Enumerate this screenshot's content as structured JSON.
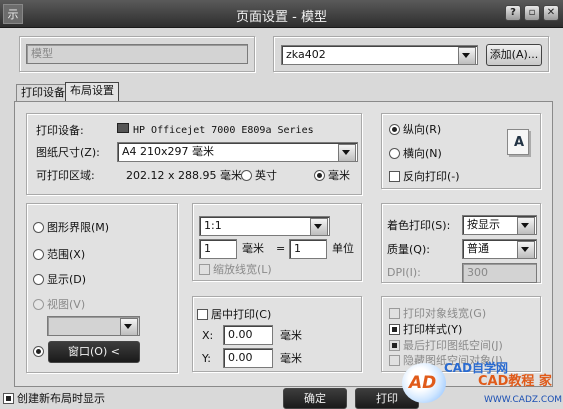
{
  "window": {
    "title": "页面设置 - 模型",
    "sys_icon": "示"
  },
  "top": {
    "layout_name_value": "模型",
    "printer_value": "zka402",
    "add_button": "添加(A)..."
  },
  "tabs": [
    {
      "label": "打印设备"
    },
    {
      "label": "布局设置"
    }
  ],
  "paper": {
    "device_label": "打印设备:",
    "device_value": "HP Officejet 7000 E809a Series",
    "size_label": "图纸尺寸(Z):",
    "size_value": "A4 210x297 毫米",
    "area_label": "可打印区域:",
    "area_value": "202.12 x 288.95 毫米",
    "unit_inch": "英寸",
    "unit_mm": "毫米"
  },
  "orientation": {
    "portrait": "纵向(R)",
    "landscape": "横向(N)",
    "reverse": "反向打印(-)",
    "preview_letter": "A"
  },
  "print_area": {
    "limits": "图形界限(M)",
    "extents": "范围(X)",
    "display": "显示(D)",
    "view": "视图(V)",
    "window_button": "窗口(O) <"
  },
  "scale": {
    "ratio": "1:1",
    "value1": "1",
    "unit1": "毫米",
    "eq": "=",
    "value2": "1",
    "unit2": "单位",
    "scale_lw": "缩放线宽(L)"
  },
  "offset": {
    "center": "居中打印(C)",
    "x_label": "X:",
    "x_value": "0.00",
    "x_unit": "毫米",
    "y_label": "Y:",
    "y_value": "0.00",
    "y_unit": "毫米"
  },
  "shade": {
    "shade_label": "着色打印(S):",
    "shade_value": "按显示",
    "quality_label": "质量(Q):",
    "quality_value": "普通",
    "dpi_label": "DPI(I):",
    "dpi_value": "300"
  },
  "options": {
    "lineweights": "打印对象线宽(G)",
    "styles": "打印样式(Y)",
    "last": "最后打印图纸空间(J)",
    "hide": "隐藏图纸空间对象(J)"
  },
  "bottom": {
    "create_new": "创建新布局时显示",
    "ok": "确定",
    "print": "打印"
  },
  "watermark": {
    "logo": "AD",
    "text1": "CAD自学网",
    "text2": "CAD教程 家",
    "url": "WWW.CADZ.COM"
  }
}
